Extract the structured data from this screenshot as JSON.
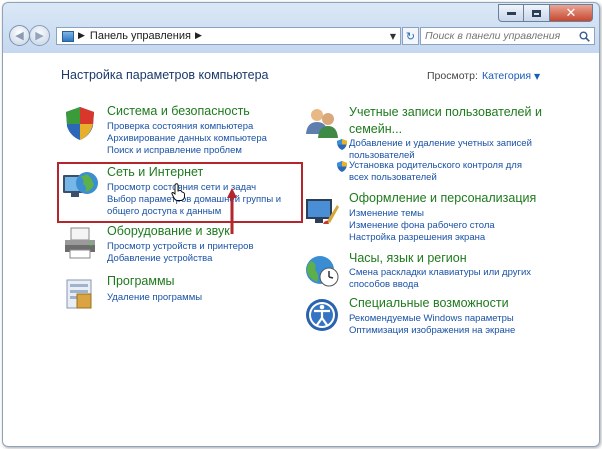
{
  "window": {
    "breadcrumb": "Панель управления",
    "search_placeholder": "Поиск в панели управления"
  },
  "header": {
    "title": "Настройка параметров компьютера",
    "view_by_label": "Просмотр:",
    "view_by_value": "Категория"
  },
  "left": [
    {
      "icon": "security-shield-icon",
      "title": "Система и безопасность",
      "links": [
        "Проверка состояния компьютера",
        "Архивирование данных компьютера",
        "Поиск и исправление проблем"
      ]
    },
    {
      "icon": "network-globe-icon",
      "title": "Сеть и Интернет",
      "links": [
        "Просмотр состояния сети и задач",
        "Выбор параметров домашней группы и общего доступа к данным"
      ]
    },
    {
      "icon": "printer-icon",
      "title": "Оборудование и звук",
      "links": [
        "Просмотр устройств и принтеров",
        "Добавление устройства"
      ]
    },
    {
      "icon": "programs-icon",
      "title": "Программы",
      "links": [
        "Удаление программы"
      ]
    }
  ],
  "right": [
    {
      "icon": "users-icon",
      "title": "Учетные записи пользователей и семейн...",
      "links": [
        "Добавление и удаление учетных записей пользователей",
        "Установка родительского контроля для всех пользователей"
      ]
    },
    {
      "icon": "appearance-icon",
      "title": "Оформление и персонализация",
      "links": [
        "Изменение темы",
        "Изменение фона рабочего стола",
        "Настройка разрешения экрана"
      ]
    },
    {
      "icon": "clock-globe-icon",
      "title": "Часы, язык и регион",
      "links": [
        "Смена раскладки клавиатуры или других способов ввода"
      ]
    },
    {
      "icon": "accessibility-icon",
      "title": "Специальные возможности",
      "links": [
        "Рекомендуемые Windows параметры",
        "Оптимизация изображения на экране"
      ]
    }
  ],
  "colors": {
    "category_title": "#1e7a1e",
    "link": "#1a52a6",
    "highlight_border": "#b2262c"
  }
}
